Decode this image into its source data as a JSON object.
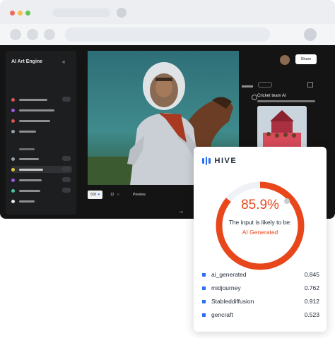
{
  "colors": {
    "accent_red": "#e8471c",
    "hive_blue": "#2d6ff3",
    "app_bg": "#141414"
  },
  "app": {
    "sidebar": {
      "title": "AI Art Engine",
      "collapse_icon": "double-chevron-left-icon",
      "items": [
        {
          "icon": "search-icon",
          "color": "#e05252"
        },
        {
          "icon": "subscriptions-icon",
          "color": "#9b59e8"
        },
        {
          "icon": "update-icon",
          "color": "#e05252"
        },
        {
          "icon": "settings-icon",
          "color": "#9aa0a6"
        },
        {
          "icon": "welcome-icon",
          "color": "#9aa0a6"
        },
        {
          "icon": "star-icon",
          "color": "#e0c341"
        },
        {
          "icon": "inspiration-icon",
          "color": "#9b59e8"
        },
        {
          "icon": "favorite-icon",
          "color": "#41c8a3"
        },
        {
          "icon": "profile-icon",
          "color": "#e6e6e6"
        }
      ]
    },
    "toolbar": {
      "zoom_value": "500",
      "count": "12",
      "preview_label": "Preview"
    },
    "right": {
      "share_label": "Share",
      "related_title": "Cricket team AI"
    }
  },
  "hive": {
    "brand": "HIVE",
    "percent": "85.9%",
    "percent_value": 0.859,
    "likely_text": "The input is likely to be:",
    "verdict": "AI Generated",
    "scores": [
      {
        "label": "ai_generated",
        "value": "0.845"
      },
      {
        "label": "midjourney",
        "value": "0.762"
      },
      {
        "label": "Stableddiffusion",
        "value": "0.912"
      },
      {
        "label": "gencraft",
        "value": "0.523"
      }
    ]
  }
}
